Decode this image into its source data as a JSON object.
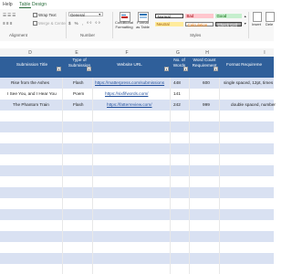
{
  "ribbon_tabs": [
    "Help",
    "Table Design"
  ],
  "ribbon": {
    "wrap_text": "Wrap Text",
    "merge_center": "Merge & Center",
    "number_format": "General",
    "conditional_formatting": "Conditional Formatting",
    "format_as_table": "Format as Table",
    "styles": {
      "normal": "Normal",
      "bad": "Bad",
      "good": "Good",
      "neutral": "Neutral",
      "calculation": "Calculation",
      "check_cell": "Check Cell"
    },
    "insert": "Insert",
    "delete": "Dele",
    "groups": {
      "alignment": "Alignment",
      "number": "Number",
      "styles": "Styles"
    }
  },
  "column_letters": [
    "D",
    "E",
    "F",
    "G",
    "H",
    "I"
  ],
  "table": {
    "headers": {
      "title": "Submission Title",
      "type": "Type of Submission",
      "url": "Website URL",
      "words": "No. of Words",
      "requirement": "Word Count Requirement",
      "format": "Format Requireme"
    },
    "rows": [
      {
        "title": "Rise from the Ashes",
        "type": "Flash",
        "url": "https://matterpress.com/submissions",
        "words": "448",
        "requirement": "600",
        "format": "single spaced, 12pt, times"
      },
      {
        "title": "I See You, and I Hear You",
        "type": "Poem",
        "url": "https://sixfifwords.com/",
        "words": "141",
        "requirement": "",
        "format": ""
      },
      {
        "title": "The Phantom Train",
        "type": "Flash",
        "url": "https://fatterreview.com/",
        "words": "242",
        "requirement": "999",
        "format": "double spaced, number"
      }
    ]
  },
  "colors": {
    "header_blue": "#2f5f9a",
    "band_blue": "#d9e1f2",
    "link": "#1f4e9b",
    "accent_green": "#2a6e3d"
  }
}
